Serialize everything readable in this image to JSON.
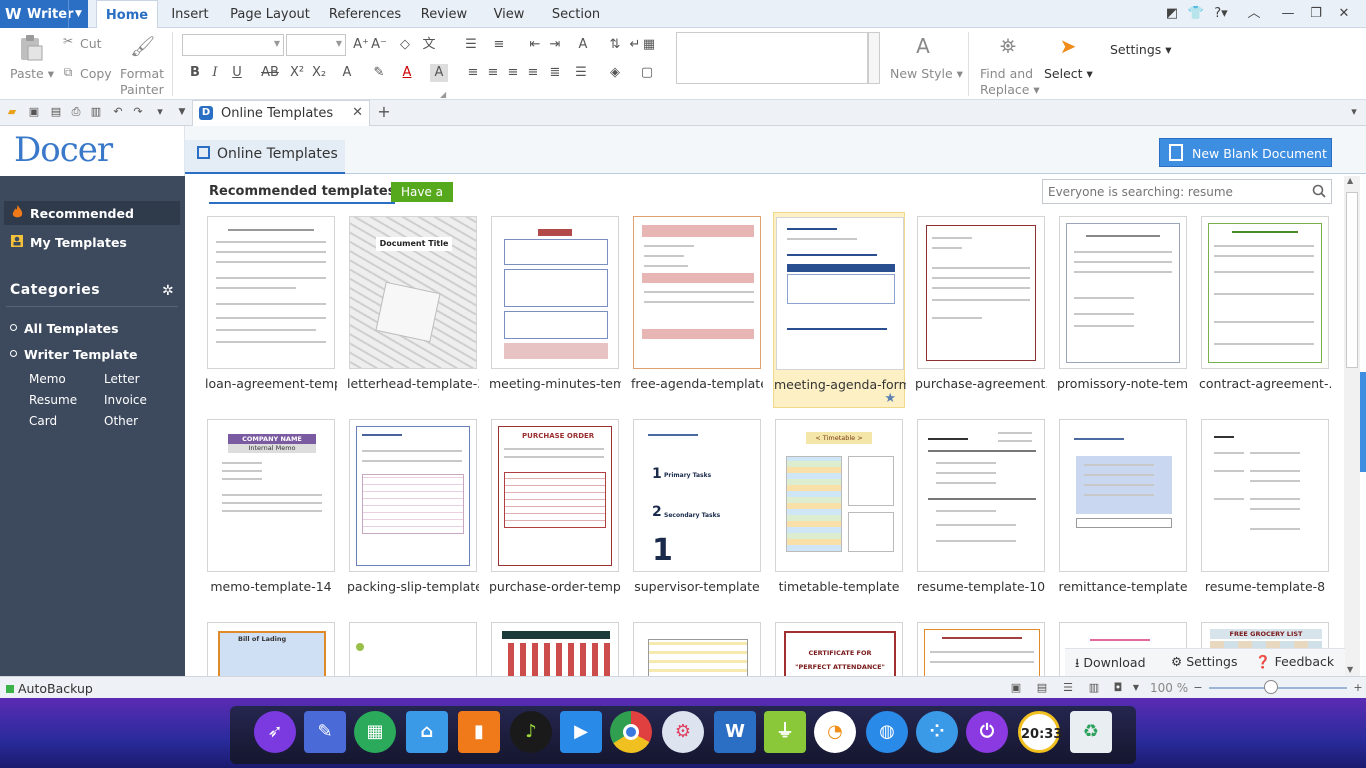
{
  "app": {
    "name": "Writer",
    "logo_glyph": "W",
    "accent": "#2b6fc4"
  },
  "ribbon_tabs": [
    "Home",
    "Insert",
    "Page Layout",
    "References",
    "Review",
    "View",
    "Section"
  ],
  "ribbon": {
    "paste": "Paste",
    "cut": "Cut",
    "copy": "Copy",
    "format_painter_1": "Format",
    "format_painter_2": "Painter",
    "new_style": "New Style",
    "find_replace_1": "Find and",
    "find_replace_2": "Replace",
    "select": "Select",
    "settings": "Settings"
  },
  "doc_tab": {
    "title": "Online Templates",
    "logo_glyph": "D"
  },
  "sidebar": {
    "logo": "Docer",
    "recommended": "Recommended",
    "my_templates": "My Templates",
    "categories_title": "Categories",
    "all_templates": "All Templates",
    "writer_template": "Writer Template",
    "subcats": [
      "Memo",
      "Letter",
      "Resume",
      "Invoice",
      "Card",
      "Other"
    ]
  },
  "main": {
    "tab_title": "Online Templates",
    "new_blank": "New Blank Document",
    "recommended_title": "Recommended templates",
    "have_a_try": "Have a try",
    "search_placeholder": "Everyone is searching: resume"
  },
  "templates": [
    "loan-agreement-temp.",
    "letterhead-template-3.",
    "meeting-minutes-tem..",
    "free-agenda-template",
    "meeting-agenda-form.",
    "purchase-agreement...",
    "promissory-note-tem..",
    "contract-agreement-...",
    "memo-template-14",
    "packing-slip-template",
    "purchase-order-temp..",
    "supervisor-template",
    "timetable-template",
    "resume-template-10",
    "remittance-template",
    "resume-template-8"
  ],
  "thumbnail_texts": {
    "letterhead": "Document Title",
    "memo_company": "COMPANY NAME",
    "memo_sub": "Internal Memo",
    "purchase_order": "PURCHASE ORDER",
    "supervisor_1": "Primary Tasks",
    "supervisor_2": "Secondary Tasks",
    "timetable": "< Timetable >",
    "bill": "Bill of Lading",
    "certificate_1": "CERTIFICATE FOR",
    "certificate_2": "\"PERFECT ATTENDANCE\"",
    "grocery": "FREE GROCERY LIST"
  },
  "bottom_actions": {
    "download": "Download",
    "settings": "Settings",
    "feedback": "Feedback"
  },
  "status": {
    "autobackup": "AutoBackup",
    "zoom": "100 %",
    "zoom_level": 0.45
  },
  "dock_icons": [
    "rocket-icon",
    "editor-icon",
    "app-store-icon",
    "file-manager-icon",
    "store-bag-icon",
    "music-icon",
    "video-icon",
    "chrome-icon",
    "settings-icon",
    "writer-icon",
    "android-icon",
    "browser-icon",
    "network-icon",
    "apps-grid-icon",
    "power-icon",
    "clock-icon",
    "trash-icon"
  ],
  "clock_text": "20:33"
}
